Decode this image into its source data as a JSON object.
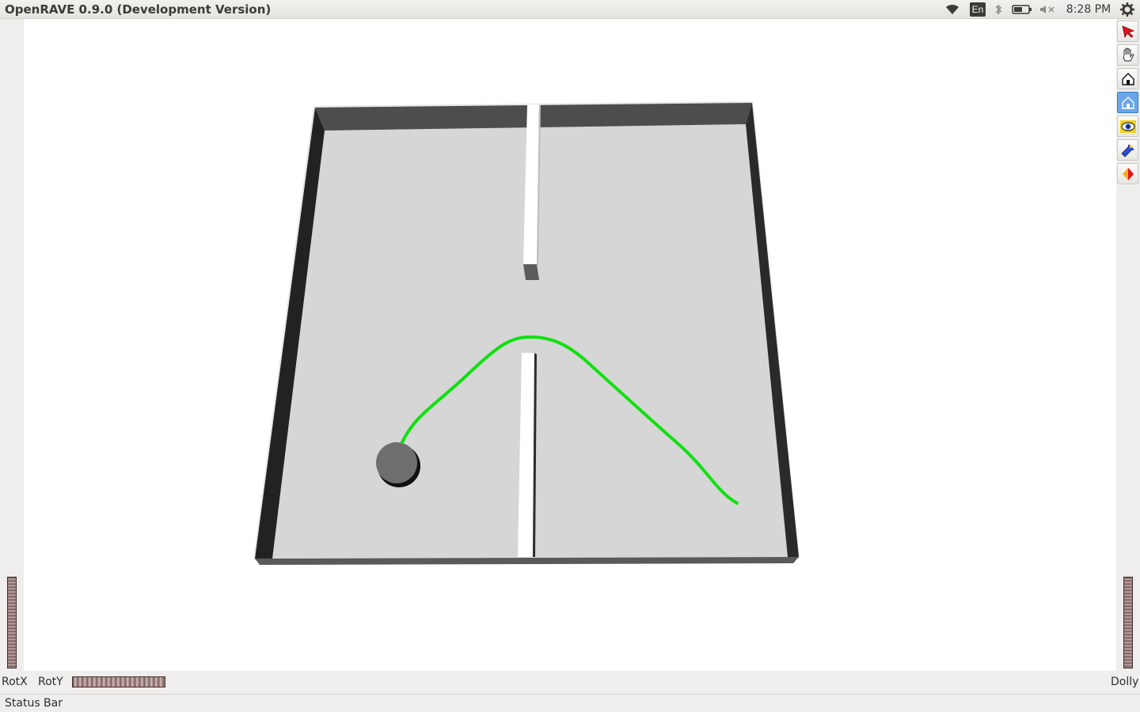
{
  "window": {
    "title": "OpenRAVE 0.9.0 (Development Version)"
  },
  "tray": {
    "language": "En",
    "clock": "8:28 PM",
    "icons": [
      "wifi-icon",
      "language-icon",
      "bluetooth-icon",
      "battery-icon",
      "volume-muted-icon",
      "power-gear-icon"
    ]
  },
  "toolbar": {
    "buttons": [
      {
        "name": "select-tool",
        "icon": "pick-arrow-icon"
      },
      {
        "name": "pan-tool",
        "icon": "hand-icon"
      },
      {
        "name": "home-view",
        "icon": "home-icon"
      },
      {
        "name": "set-home-view",
        "icon": "set-home-icon",
        "active": true
      },
      {
        "name": "view-all",
        "icon": "eye-icon"
      },
      {
        "name": "seek-tool",
        "icon": "flashlight-icon"
      },
      {
        "name": "perspective-toggle",
        "icon": "cube-icon"
      }
    ]
  },
  "wheels": {
    "rotx_label": "RotX",
    "roty_label": "RotY",
    "dolly_label": "Dolly"
  },
  "statusbar": {
    "text": "Status Bar"
  },
  "scene": {
    "floor_color": "#d6d6d6",
    "wall_inner_color": "#222222",
    "wall_top_color": "#4d4d4d",
    "obstacle_color": "#ffffff",
    "robot_color": "#6e6e6e",
    "path_color": "#11e011"
  }
}
